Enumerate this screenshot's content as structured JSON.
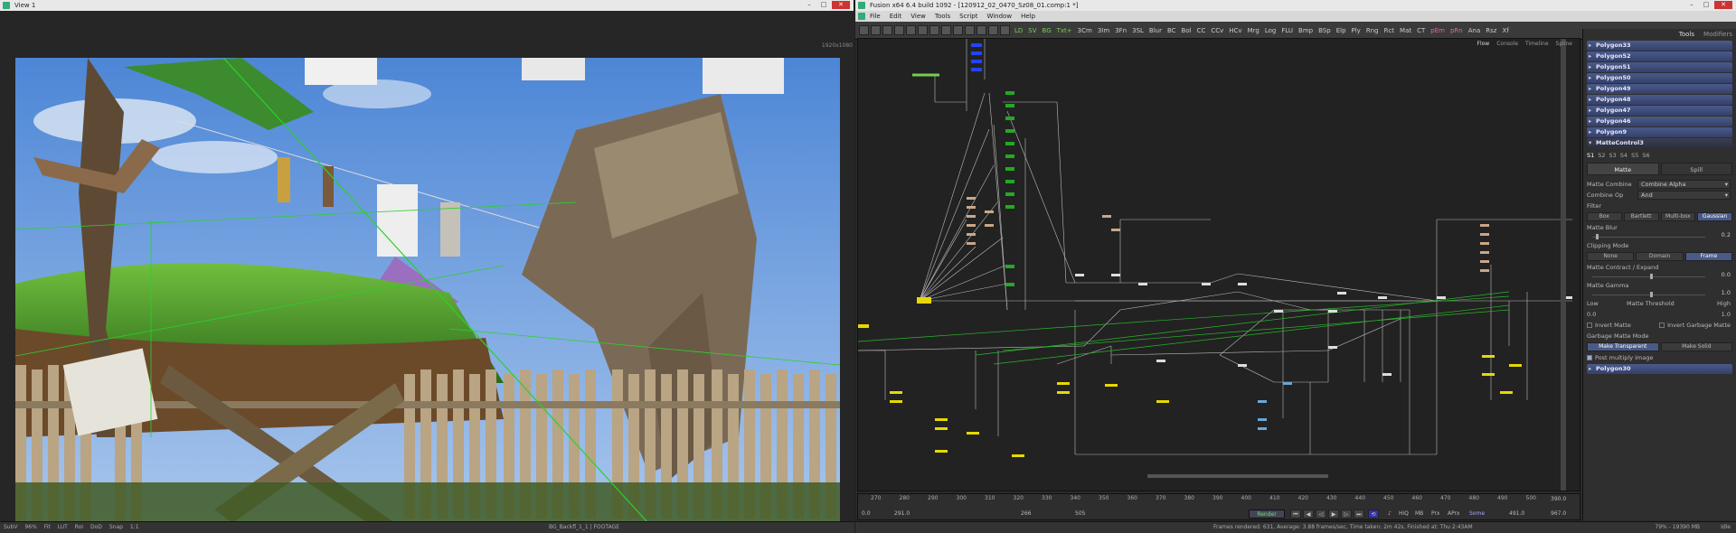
{
  "viewer": {
    "title": "View 1",
    "resolution": "1920x1080",
    "footage_label": "BG_Backfl_1_1 | FOOTAGE",
    "status_items": [
      "SubV",
      "96%",
      "Fit",
      "LUT",
      "RoI",
      "DoD",
      "Snap",
      "1:1"
    ]
  },
  "fusion": {
    "title": "Fusion x64 6.4 build 1092 - [120912_02_0470_Sz08_01.comp:1 *]",
    "menu": [
      "File",
      "Edit",
      "View",
      "Tools",
      "Script",
      "Window",
      "Help"
    ],
    "tools": [
      {
        "l": "LD",
        "c": "g"
      },
      {
        "l": "SV",
        "c": "g"
      },
      {
        "l": "BG",
        "c": "g"
      },
      {
        "l": "Txt+",
        "c": "g"
      },
      {
        "l": "3Cm",
        "c": ""
      },
      {
        "l": "3Im",
        "c": ""
      },
      {
        "l": "3Fn",
        "c": ""
      },
      {
        "l": "3SL",
        "c": ""
      },
      {
        "l": "Blur",
        "c": ""
      },
      {
        "l": "BC",
        "c": ""
      },
      {
        "l": "Bol",
        "c": ""
      },
      {
        "l": "CC",
        "c": ""
      },
      {
        "l": "CCv",
        "c": ""
      },
      {
        "l": "HCv",
        "c": ""
      },
      {
        "l": "Mrg",
        "c": ""
      },
      {
        "l": "Log",
        "c": ""
      },
      {
        "l": "FLU",
        "c": ""
      },
      {
        "l": "Bmp",
        "c": ""
      },
      {
        "l": "BSp",
        "c": ""
      },
      {
        "l": "Elp",
        "c": ""
      },
      {
        "l": "Ply",
        "c": ""
      },
      {
        "l": "Rng",
        "c": ""
      },
      {
        "l": "Rct",
        "c": ""
      },
      {
        "l": "Mat",
        "c": ""
      },
      {
        "l": "CT",
        "c": ""
      },
      {
        "l": "pEm",
        "c": "p"
      },
      {
        "l": "pRn",
        "c": "p"
      },
      {
        "l": "Ana",
        "c": ""
      },
      {
        "l": "Rsz",
        "c": ""
      },
      {
        "l": "Xf",
        "c": ""
      }
    ],
    "flow_tabs": [
      "Flow",
      "Console",
      "Timeline",
      "Spline"
    ],
    "timeline": {
      "ticks": [
        "270",
        "280",
        "290",
        "300",
        "310",
        "320",
        "330",
        "340",
        "350",
        "360",
        "370",
        "380",
        "390",
        "400",
        "410",
        "420",
        "430",
        "440",
        "450",
        "460",
        "470",
        "480",
        "490",
        "500"
      ],
      "start": "0.0",
      "current": "291.0",
      "render_start": "266",
      "render_end": "505",
      "render_label": "Render",
      "hiq": "HiQ",
      "mb": "MB",
      "prx": "Prx",
      "aprx": "APrx",
      "some": "Some",
      "end_global": "491.0",
      "end_total": "967.0",
      "in_point": "390.0"
    },
    "status": {
      "stats": "Frames rendered: 631,  Average: 3.88 frames/sec,  Time taken: 2m 42s,  Finished at: Thu 2:43AM",
      "memory": "79% - 19390 MB",
      "state": "Idle"
    }
  },
  "inspector": {
    "tabs": [
      "Tools",
      "Modifiers"
    ],
    "collapsed_top": [
      "Polygon33",
      "Polygon52",
      "Polygon51",
      "Polygon50",
      "Polygon49",
      "Polygon48",
      "Polygon47",
      "Polygon46",
      "Polygon9"
    ],
    "open_tool": "MatteControl3",
    "channel_tabs": [
      "S1",
      "S2",
      "S3",
      "S4",
      "S5",
      "S6"
    ],
    "sub_tabs": [
      "Matte",
      "Spill"
    ],
    "matte_combine_label": "Matte Combine",
    "matte_combine_value": "Combine Alpha",
    "combine_op_label": "Combine Op",
    "combine_op_value": "And",
    "filter_label": "Filter",
    "filter_options": [
      "Box",
      "Bartlett",
      "Multi-box",
      "Gaussian"
    ],
    "matte_blur_label": "Matte Blur",
    "matte_blur_value": "0.2",
    "clipping_label": "Clipping Mode",
    "clipping_options": [
      "None",
      "Domain",
      "Frame"
    ],
    "contract_label": "Matte Contract / Expand",
    "contract_value": "0.0",
    "gamma_label": "Matte Gamma",
    "gamma_value": "1.0",
    "low_label": "Low",
    "threshold_label": "Matte Threshold",
    "high_label": "High",
    "low_value": "0.0",
    "high_value": "1.0",
    "invert_matte": "Invert Matte",
    "invert_garbage": "Invert Garbage Matte",
    "garbage_mode_label": "Garbage Matte Mode",
    "garbage_options": [
      "Make Transparent",
      "Make Solid"
    ],
    "post_multiply": "Post multiply image",
    "collapsed_bottom": [
      "Polygon30"
    ]
  },
  "colors": {
    "accent": "#4a5a88",
    "node_yellow": "#e8d800",
    "node_blue": "#2244ff",
    "node_green": "#22aa22"
  }
}
